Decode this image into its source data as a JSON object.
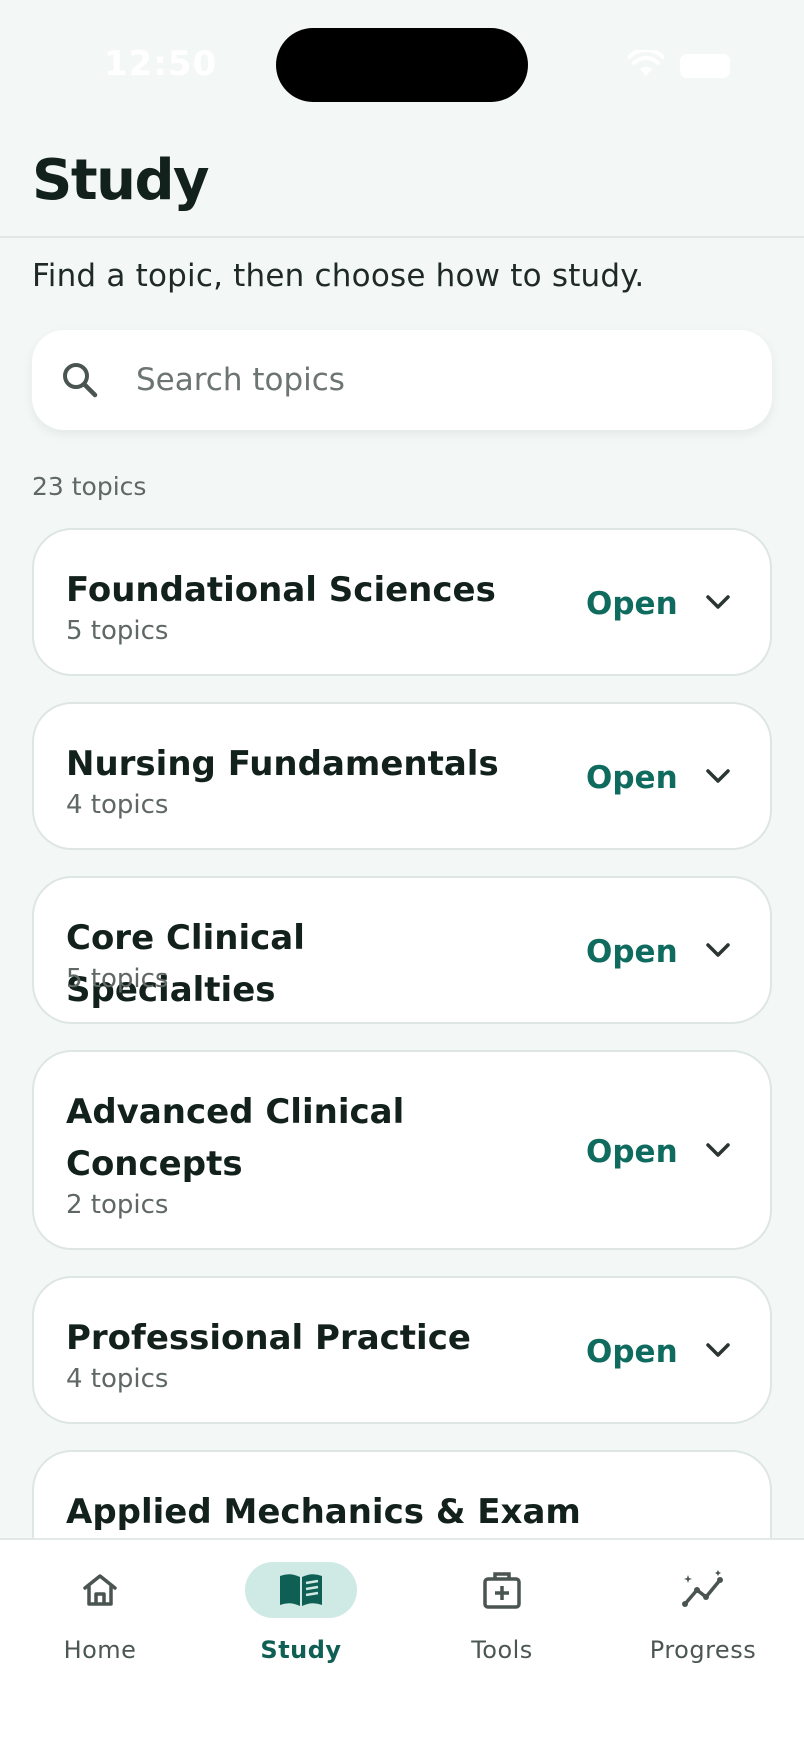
{
  "status_bar": {
    "time": "12:50"
  },
  "header": {
    "title": "Study",
    "subtitle": "Find a topic, then choose how to study."
  },
  "search": {
    "placeholder": "Search topics",
    "value": ""
  },
  "topic_count": "23 topics",
  "categories": [
    {
      "title": "Foundational Sciences",
      "count": "5 topics",
      "action": "Open"
    },
    {
      "title": "Nursing Fundamentals",
      "count": "4 topics",
      "action": "Open"
    },
    {
      "title": "Core Clinical Specialties",
      "count": "5 topics",
      "action": "Open"
    },
    {
      "title": "Advanced Clinical Concepts",
      "count": "2 topics",
      "action": "Open"
    },
    {
      "title": "Professional Practice",
      "count": "4 topics",
      "action": "Open"
    },
    {
      "title": "Applied Mechanics & Exam",
      "count": "",
      "action": ""
    }
  ],
  "tab_bar": {
    "tabs": [
      {
        "label": "Home",
        "icon": "home-icon",
        "active": false
      },
      {
        "label": "Study",
        "icon": "book-icon",
        "active": true
      },
      {
        "label": "Tools",
        "icon": "medical-kit-icon",
        "active": false
      },
      {
        "label": "Progress",
        "icon": "progress-chart-icon",
        "active": false
      }
    ]
  },
  "colors": {
    "accent": "#0f6b5e",
    "active_tab_bg": "#cfeae4",
    "background": "#f3f7f6"
  }
}
